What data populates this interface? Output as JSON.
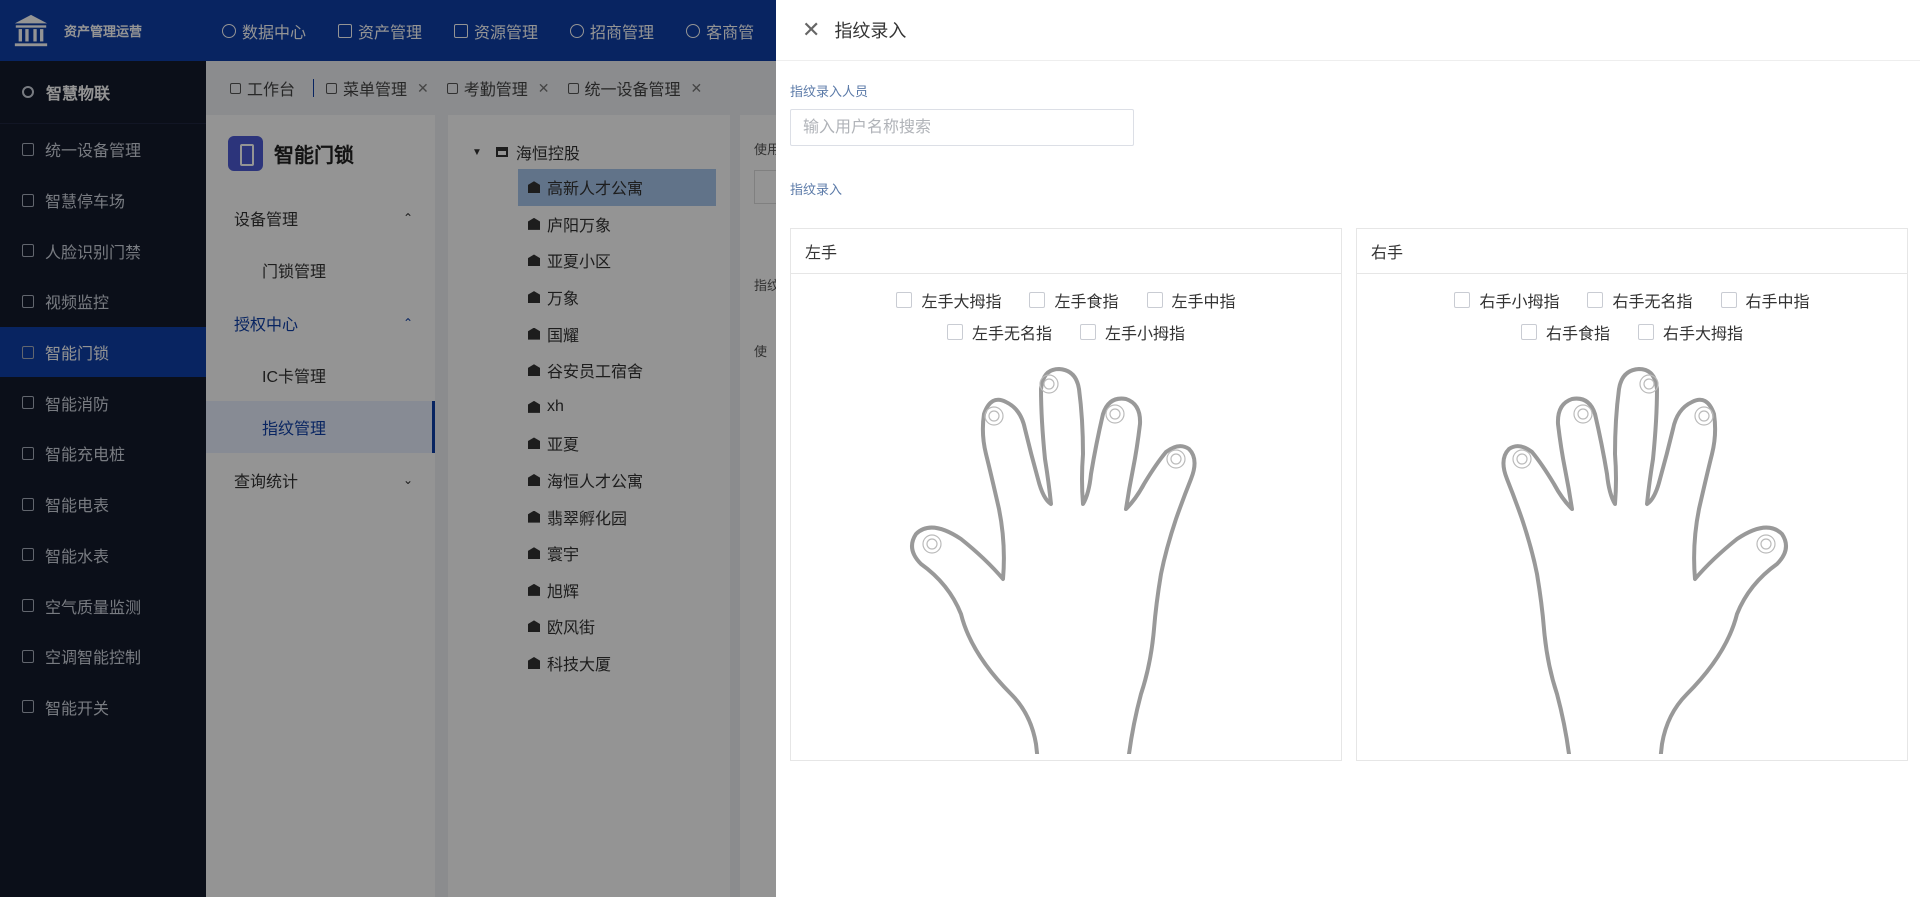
{
  "app": {
    "brand_name": "资产管理运营"
  },
  "topnav": [
    {
      "label": "数据中心",
      "icon": "dashboard-icon"
    },
    {
      "label": "资产管理",
      "icon": "cube-icon"
    },
    {
      "label": "资源管理",
      "icon": "building-icon"
    },
    {
      "label": "招商管理",
      "icon": "tag-icon"
    },
    {
      "label": "客商管",
      "icon": "user-icon"
    }
  ],
  "sidebar": {
    "header": "智慧物联",
    "items": [
      {
        "label": "统一设备管理",
        "active": false
      },
      {
        "label": "智慧停车场",
        "active": false
      },
      {
        "label": "人脸识别门禁",
        "active": false
      },
      {
        "label": "视频监控",
        "active": false
      },
      {
        "label": "智能门锁",
        "active": true
      },
      {
        "label": "智能消防",
        "active": false
      },
      {
        "label": "智能充电桩",
        "active": false
      },
      {
        "label": "智能电表",
        "active": false
      },
      {
        "label": "智能水表",
        "active": false
      },
      {
        "label": "空气质量监测",
        "active": false
      },
      {
        "label": "空调智能控制",
        "active": false
      },
      {
        "label": "智能开关",
        "active": false
      }
    ]
  },
  "tabs": [
    {
      "label": "工作台",
      "closable": false
    },
    {
      "label": "菜单管理",
      "closable": true
    },
    {
      "label": "考勤管理",
      "closable": true
    },
    {
      "label": "统一设备管理",
      "closable": true
    }
  ],
  "submenu": {
    "title": "智能门锁",
    "groups": [
      {
        "label": "设备管理",
        "chevron": "⌃",
        "children": [
          "门锁管理"
        ]
      },
      {
        "label": "授权中心",
        "chevron": "⌃",
        "children": [
          "IC卡管理",
          "指纹管理"
        ]
      },
      {
        "label": "查询统计",
        "chevron": "⌄",
        "children": []
      }
    ],
    "active_leaf": "指纹管理"
  },
  "tree": {
    "root": "海恒控股",
    "nodes": [
      "高新人才公寓",
      "庐阳万象",
      "亚夏小区",
      "万象",
      "国耀",
      "谷安员工宿舍",
      "xh",
      "亚夏",
      "海恒人才公寓",
      "翡翠孵化园",
      "寰宇",
      "旭辉",
      "欧风街",
      "科技大厦"
    ],
    "selected": "高新人才公寓"
  },
  "background_panel": {
    "label_top": "使用",
    "label_mid": "指纹",
    "label_table": "使"
  },
  "drawer": {
    "title": "指纹录入",
    "person_label": "指纹录入人员",
    "search_placeholder": "输入用户名称搜索",
    "search_value": "",
    "enroll_label": "指纹录入",
    "left_hand": {
      "title": "左手",
      "fingers": [
        "左手大拇指",
        "左手食指",
        "左手中指",
        "左手无名指",
        "左手小拇指"
      ]
    },
    "right_hand": {
      "title": "右手",
      "fingers": [
        "右手小拇指",
        "右手无名指",
        "右手中指",
        "右手食指",
        "右手大拇指"
      ]
    }
  },
  "colors": {
    "primary": "#0e3fa8",
    "sidebar_bg": "#131a2b",
    "label": "#5b7aa8"
  }
}
